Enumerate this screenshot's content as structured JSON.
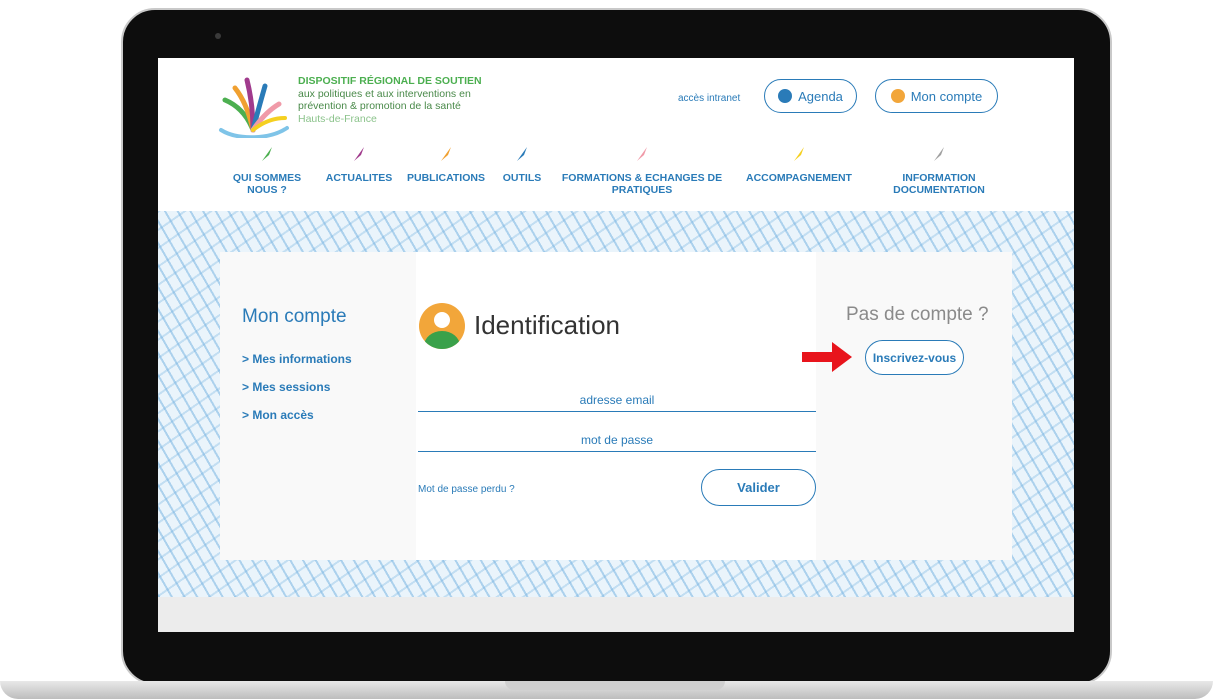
{
  "header": {
    "org_lines": [
      "DISPOSITIF RÉGIONAL DE SOUTIEN",
      "aux politiques et aux interventions en",
      "prévention & promotion de la santé",
      "Hauts-de-France"
    ],
    "intranet_link": "accès intranet",
    "agenda_label": "Agenda",
    "account_label": "Mon compte"
  },
  "nav": [
    {
      "line1": "QUI SOMMES",
      "line2": "NOUS ?",
      "color": "#4caf50"
    },
    {
      "line1": "ACTUALITES",
      "line2": "",
      "color": "#a03a8c"
    },
    {
      "line1": "PUBLICATIONS",
      "line2": "",
      "color": "#f0a030"
    },
    {
      "line1": "OUTILS",
      "line2": "",
      "color": "#2a7bb8"
    },
    {
      "line1": "FORMATIONS & ECHANGES DE",
      "line2": "PRATIQUES",
      "color": "#f09aa8"
    },
    {
      "line1": "ACCOMPAGNEMENT",
      "line2": "",
      "color": "#f5d020"
    },
    {
      "line1": "INFORMATION",
      "line2": "DOCUMENTATION",
      "color": "#a0a0a0"
    }
  ],
  "sidebar": {
    "title": "Mon compte",
    "links": [
      "> Mes informations",
      "> Mes sessions",
      "> Mon accès"
    ]
  },
  "login": {
    "title": "Identification",
    "email_placeholder": "adresse email",
    "password_placeholder": "mot de passe",
    "lost_password": "Mot de passe perdu ?",
    "submit": "Valider"
  },
  "signup": {
    "title": "Pas de compte ?",
    "button": "Inscrivez-vous"
  },
  "colors": {
    "accent": "#2a7bb8",
    "arrow": "#e8141c",
    "pattern_bg": "#eaf4fb"
  }
}
